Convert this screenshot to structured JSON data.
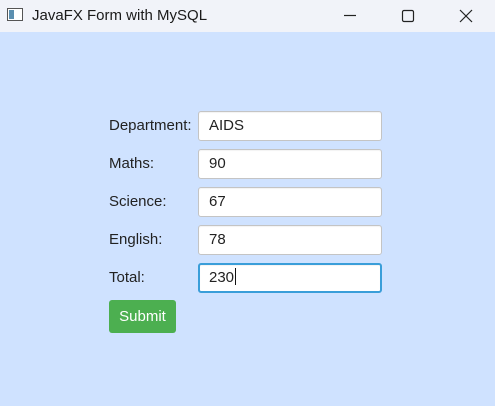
{
  "window": {
    "title": "JavaFX Form with MySQL",
    "app_icon": "java-window-icon",
    "controls": [
      "minimize-icon",
      "maximize-icon",
      "close-icon"
    ]
  },
  "form": {
    "fields": [
      {
        "label": "Department:",
        "value": "AIDS"
      },
      {
        "label": "Maths:",
        "value": "90"
      },
      {
        "label": "Science:",
        "value": "67"
      },
      {
        "label": "English:",
        "value": "78"
      },
      {
        "label": "Total:",
        "value": "230",
        "focused": true
      }
    ],
    "submit_label": "Submit"
  },
  "colors": {
    "background": "#cfe2ff",
    "titlebar": "#f1f3f9",
    "submit_button": "#4caf50",
    "focus_border": "#3a9ed9"
  }
}
